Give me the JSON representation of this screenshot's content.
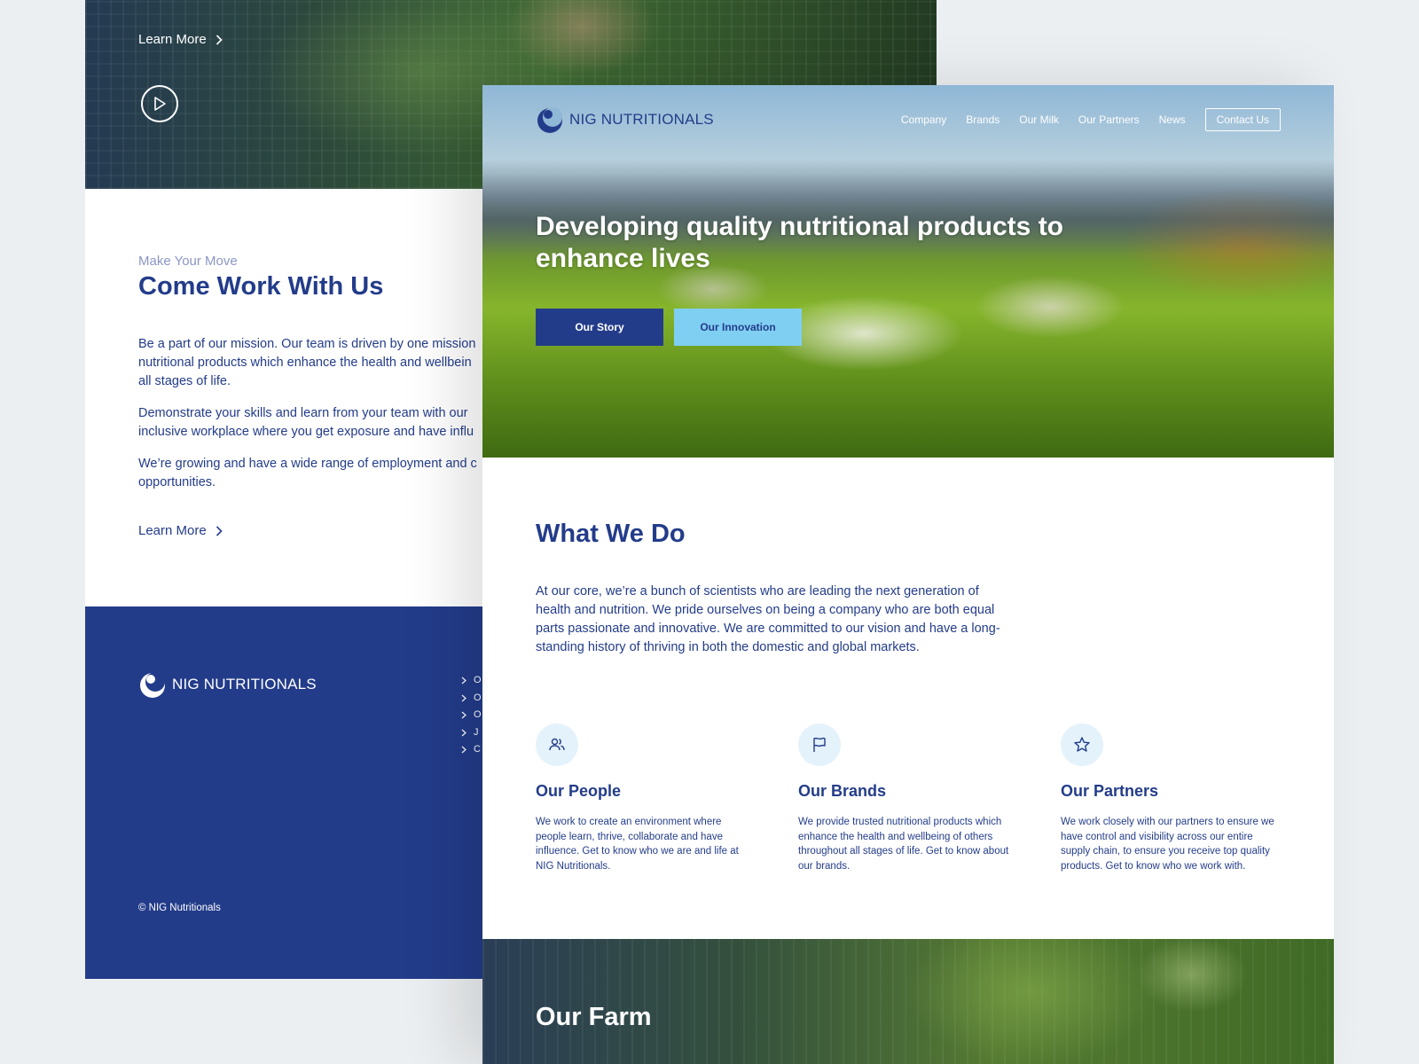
{
  "brand": {
    "name": "NIG NUTRITIONALS",
    "primary_color": "#233c8a",
    "accent_color": "#7fcff2",
    "logo_icon": "crescent-logo-icon"
  },
  "back_page": {
    "hero": {
      "learn_more": "Learn More",
      "play_icon": "play-circle-icon"
    },
    "work": {
      "eyebrow": "Make Your Move",
      "title": "Come Work With Us",
      "paragraphs": [
        "Be a part of our mission. Our team is driven by one mission\nnutritional products which enhance the health and wellbein\nall stages of life.",
        "Demonstrate your skills and learn from your team with our\ninclusive workplace where you get exposure and have influ",
        "We’re growing and have a wide range of employment and c\nopportunities."
      ],
      "learn_more": "Learn More"
    },
    "footer": {
      "logo_text": "NIG NUTRITIONALS",
      "links": [
        "O",
        "O",
        "O",
        "J",
        "C"
      ],
      "copyright": "© NIG Nutritionals"
    }
  },
  "front_page": {
    "nav": {
      "logo_text": "NIG NUTRITIONALS",
      "items": [
        "Company",
        "Brands",
        "Our Milk",
        "Our Partners",
        "News"
      ],
      "contact": "Contact Us"
    },
    "hero": {
      "title": "Developing quality nutritional products to\nenhance lives",
      "primary_button": "Our Story",
      "secondary_button": "Our Innovation"
    },
    "what_we_do": {
      "title": "What We Do",
      "paragraph": "At our core, we’re a bunch of scientists who are leading the next generation of\nhealth and nutrition. We pride ourselves on being a company who are both equal\nparts passionate and innovative. We are committed to our vision and have a long-\nstanding history of thriving in both the domestic and global markets."
    },
    "features": [
      {
        "icon": "people-icon",
        "title": "Our People",
        "text": "We work to create an environment where\npeople learn, thrive, collaborate and have\ninfluence. Get to know who we are and life at\nNIG Nutritionals."
      },
      {
        "icon": "flag-icon",
        "title": "Our Brands",
        "text": "We provide trusted nutritional products which\nenhance the health and wellbeing of others\nthroughout all stages of life. Get to know about\nour brands."
      },
      {
        "icon": "star-icon",
        "title": "Our Partners",
        "text": "We work closely with our partners to ensure we\nhave control and visibility across our entire\nsupply chain, to ensure you receive top quality\nproducts. Get to know who we work with."
      }
    ],
    "farm": {
      "title": "Our Farm"
    }
  }
}
